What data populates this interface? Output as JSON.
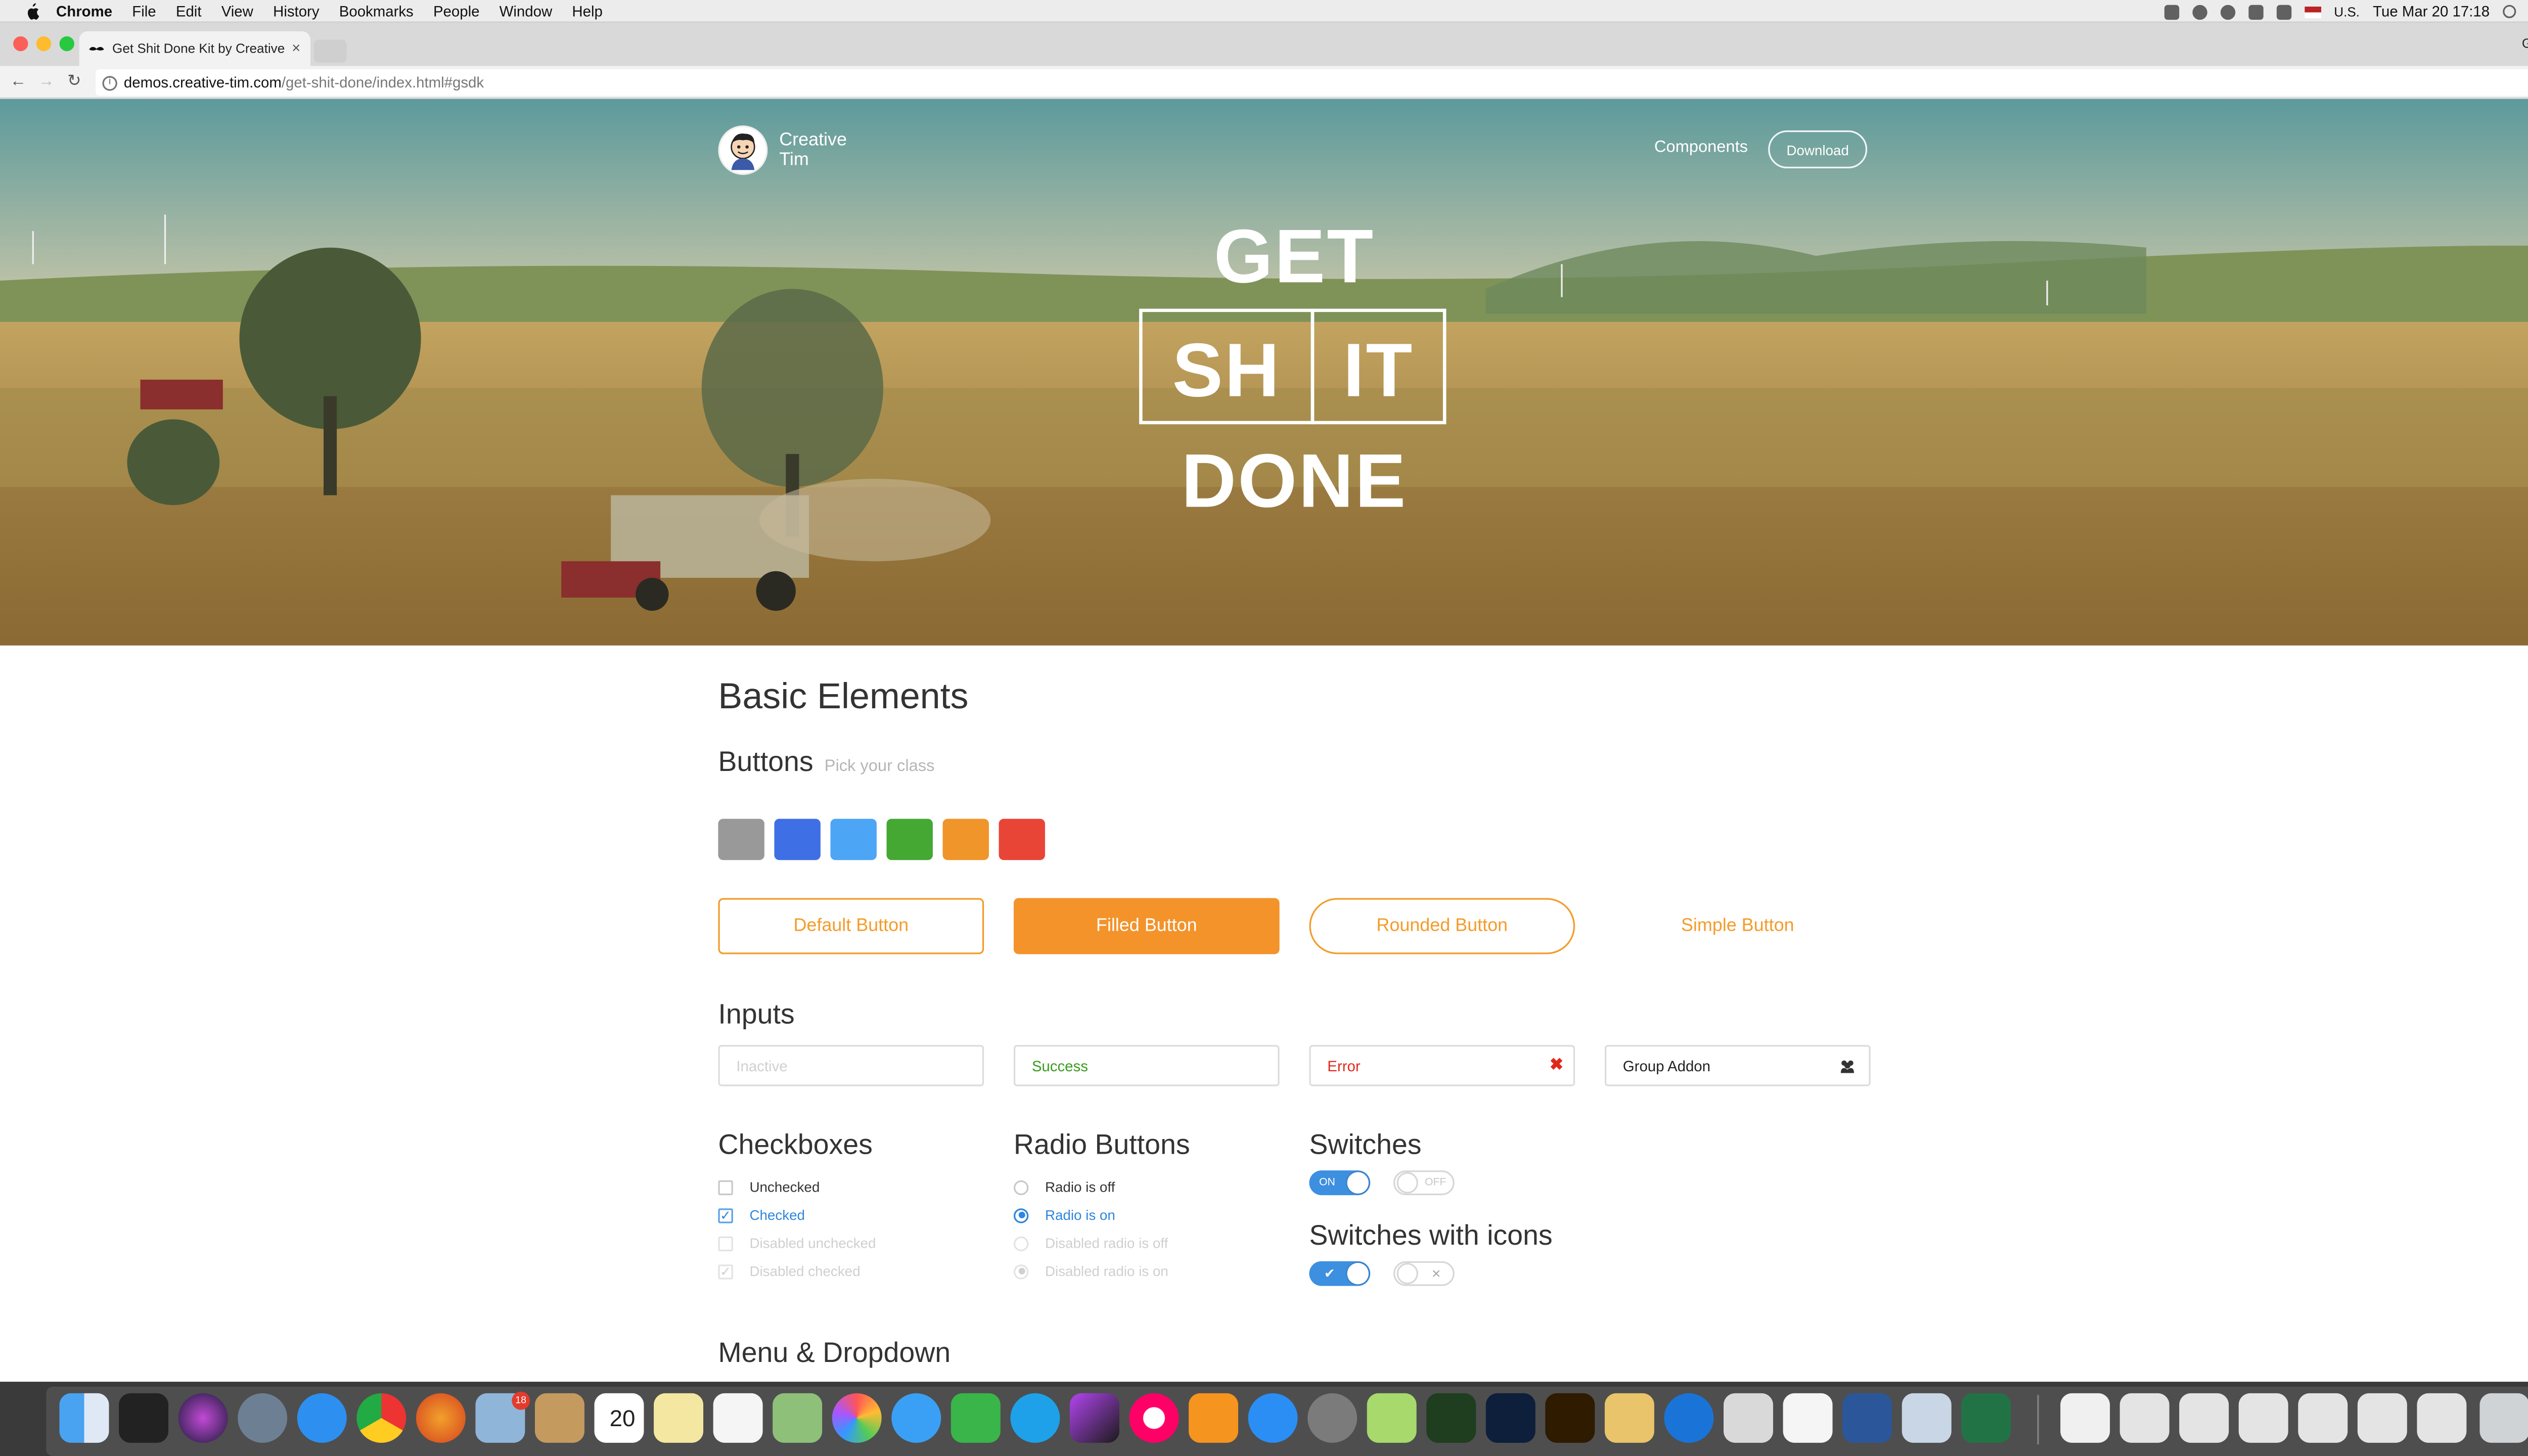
{
  "menubar": {
    "items": [
      "Chrome",
      "File",
      "Edit",
      "View",
      "History",
      "Bookmarks",
      "People",
      "Window",
      "Help"
    ],
    "input_source": "U.S.",
    "clock": "Tue Mar 20  17:18"
  },
  "browser": {
    "tab_title": "Get Shit Done Kit by Creative",
    "profile": "GridGum",
    "url_host": "demos.creative-tim.com",
    "url_path": "/get-shit-done/index.html#gsdk"
  },
  "hero": {
    "brand": "Creative Tim",
    "nav_components": "Components",
    "nav_download": "Download",
    "word_get": "GET",
    "word_sh": "SH",
    "word_it": "IT",
    "word_done": "DONE"
  },
  "content": {
    "title": "Basic Elements",
    "buttons_heading": "Buttons",
    "buttons_hint": "Pick your class",
    "swatch_colors": [
      "#999999",
      "#3e6fe5",
      "#4da5f5",
      "#44a833",
      "#f0952a",
      "#e84537"
    ],
    "buttons": {
      "default": "Default Button",
      "filled": "Filled Button",
      "rounded": "Rounded Button",
      "simple": "Simple Button"
    },
    "inputs_heading": "Inputs",
    "inputs": {
      "inactive_placeholder": "Inactive",
      "success_value": "Success",
      "error_value": "Error",
      "addon_value": "Group Addon"
    },
    "checkboxes_heading": "Checkboxes",
    "checkboxes": [
      "Unchecked",
      "Checked",
      "Disabled unchecked",
      "Disabled checked"
    ],
    "radios_heading": "Radio Buttons",
    "radios": [
      "Radio is off",
      "Radio is on",
      "Disabled radio is off",
      "Disabled radio is on"
    ],
    "switches_heading": "Switches",
    "switch_on_label": "ON",
    "switch_off_label": "OFF",
    "switches_icons_heading": "Switches with icons",
    "menu_heading": "Menu & Dropdown"
  },
  "dock": {
    "mail_badge": "18",
    "calendar_day": "20"
  },
  "colors": {
    "accent": "#f39c2a",
    "primary": "#3d8fe0",
    "success": "#3a9b1f",
    "danger": "#e0291c"
  }
}
